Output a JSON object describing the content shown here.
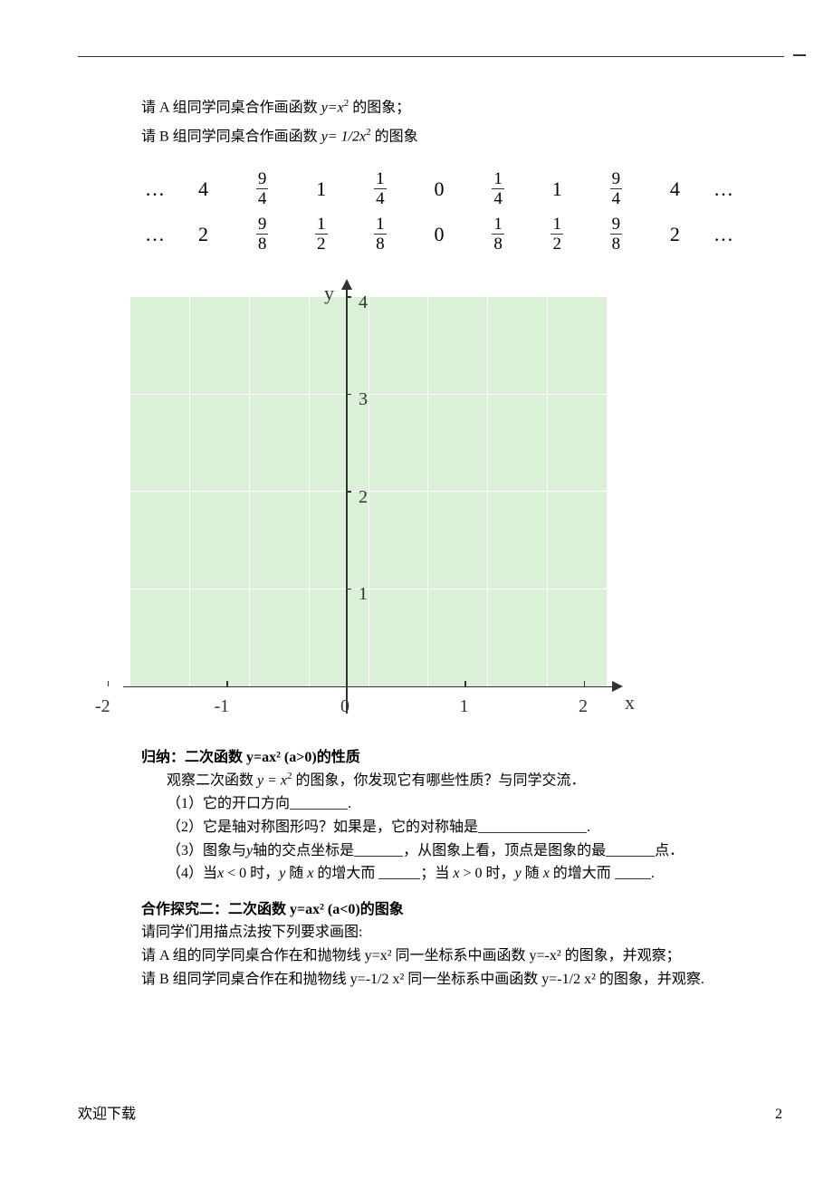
{
  "line1_prefix": "请 A 组同学同桌合作画函数 ",
  "line1_fx": "y=x",
  "line1_suffix": " 的图象；",
  "line2_prefix": "请 B 组同学同桌合作画函数 ",
  "line2_fx": "y= 1/2x",
  "line2_suffix": " 的图象",
  "chart_data": {
    "type": "table",
    "row1": [
      "…",
      "4",
      {
        "n": "9",
        "d": "4"
      },
      "1",
      {
        "n": "1",
        "d": "4"
      },
      "0",
      {
        "n": "1",
        "d": "4"
      },
      "1",
      {
        "n": "9",
        "d": "4"
      },
      "4",
      "…"
    ],
    "row2": [
      "…",
      "2",
      {
        "n": "9",
        "d": "8"
      },
      {
        "n": "1",
        "d": "2"
      },
      {
        "n": "1",
        "d": "8"
      },
      "0",
      {
        "n": "1",
        "d": "8"
      },
      {
        "n": "1",
        "d": "2"
      },
      {
        "n": "9",
        "d": "8"
      },
      "2",
      "…"
    ],
    "grid": {
      "xLabel": "x",
      "yLabel": "y",
      "xTicks": [
        "-2",
        "-1",
        "0",
        "1",
        "2"
      ],
      "yTicks": [
        "1",
        "2",
        "3",
        "4"
      ],
      "xRange": [
        -2,
        2
      ],
      "yRange": [
        0,
        4
      ]
    }
  },
  "sec1_title": "归纳：二次函数 y=ax² (a>0)的性质",
  "sec1_obs_prefix": "观察二次函数 ",
  "sec1_obs_fx": "y = x",
  "sec1_obs_suffix": " 的图象，你发现它有哪些性质？与同学交流．",
  "q1": "（1）它的开口方向________.",
  "q2_prefix": "（2）它是轴对称图形吗？如果是，它的对称轴是",
  "q2_suffix": ".",
  "q3_prefix": "（3）图象与",
  "q3_mid1": "轴的交点坐标是",
  "q3_mid2": "，从图象上看，顶点是图象的最",
  "q3_suffix": "点．",
  "q4_prefix": "（4）当",
  "q4_m1": " < 0 时，",
  "q4_m2": " 随 ",
  "q4_m3": " 的增大而 ",
  "q4_m4": "；当 ",
  "q4_m5": " > 0 时，",
  "q4_m6": " 随 ",
  "q4_m7": " 的增大而 ",
  "q4_suffix": ".",
  "x": "x",
  "y": "y",
  "sec2_title": "合作探究二：二次函数 y=ax² (a<0)的图象",
  "sec2_line1": "请同学们用描点法按下列要求画图:",
  "sec2_line2": "请 A 组的同学同桌合作在和抛物线 y=x² 同一坐标系中画函数 y=-x² 的图象，并观察；",
  "sec2_line3": "请 B 组同学同桌合作在和抛物线 y=-1/2 x² 同一坐标系中画函数 y=-1/2 x² 的图象，并观察.",
  "footer": "欢迎下载",
  "page": "2"
}
